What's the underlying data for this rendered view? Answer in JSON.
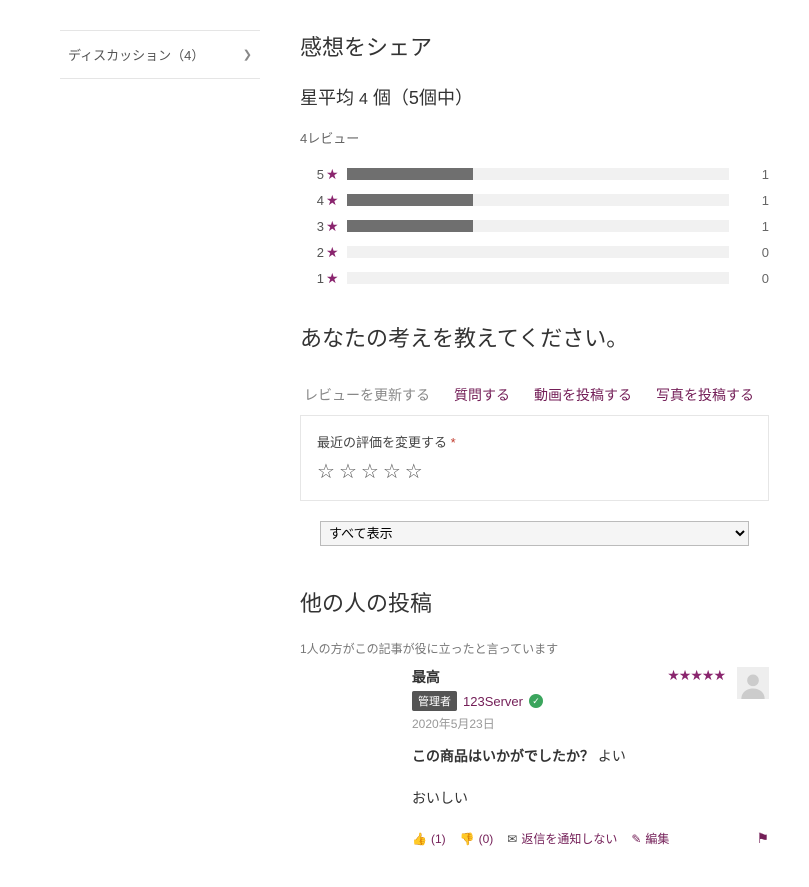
{
  "sidebar": {
    "discussion_label": "ディスカッション（4）"
  },
  "share": {
    "title": "感想をシェア",
    "avg_prefix": "星平均",
    "avg_value": "4",
    "avg_suffix": "個（5個中）",
    "review_count_text": "4レビュー",
    "thoughts_title": "あなたの考えを教えてください。"
  },
  "histogram": [
    {
      "label": "5",
      "count": "1",
      "pct": 33
    },
    {
      "label": "4",
      "count": "1",
      "pct": 33
    },
    {
      "label": "3",
      "count": "1",
      "pct": 33
    },
    {
      "label": "2",
      "count": "0",
      "pct": 0
    },
    {
      "label": "1",
      "count": "0",
      "pct": 0
    }
  ],
  "tabs": {
    "update_review": "レビューを更新する",
    "ask_question": "質問する",
    "post_video": "動画を投稿する",
    "post_photo": "写真を投稿する"
  },
  "form": {
    "change_rating_label": "最近の評価を変更する",
    "required_mark": "*"
  },
  "filter": {
    "selected": "すべて表示"
  },
  "others": {
    "title": "他の人の投稿",
    "helpful_text": "1人の方がこの記事が役に立ったと言っています"
  },
  "post": {
    "title": "最高",
    "badge": "管理者",
    "author": "123Server",
    "date": "2020年5月23日",
    "question": "この商品はいかがでしたか？",
    "answer": "よい",
    "body": "おいしい",
    "up_count": "(1)",
    "down_count": "(0)",
    "notify": "返信を通知しない",
    "edit": "編集"
  }
}
